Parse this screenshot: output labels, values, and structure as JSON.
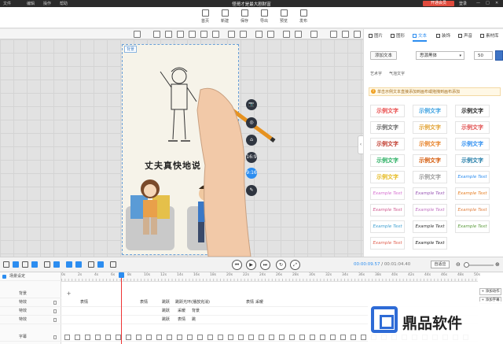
{
  "titlebar": {
    "menu": [
      "文件",
      "编辑",
      "操作",
      "帮助"
    ],
    "title": "怪哥才是最大剧财富",
    "vip": "开通会员",
    "login": "登录",
    "window_controls": [
      "—",
      "□",
      "✕"
    ]
  },
  "toolbar": {
    "items": [
      {
        "label": "首页",
        "icon": "home-icon"
      },
      {
        "label": "新建",
        "icon": "new-icon"
      },
      {
        "label": "保存",
        "icon": "save-icon"
      },
      {
        "label": "导出",
        "icon": "export-icon"
      },
      {
        "label": "预览",
        "icon": "preview-icon"
      },
      {
        "label": "发布",
        "icon": "publish-icon"
      }
    ]
  },
  "canvas": {
    "stage_label": "背景",
    "caption": "丈夫真快地说",
    "side_buttons": [
      "📷",
      "◎",
      "⌂",
      "16:9",
      "9:16",
      "✎"
    ]
  },
  "right_panel": {
    "tabs": [
      "图片",
      "图形",
      "文本",
      "装饰",
      "声音",
      "素材库"
    ],
    "active_tab": "文本",
    "add_text": "添加文本",
    "font": "思源黑体",
    "font_size": "50",
    "color": "#3e74c6",
    "subtabs": [
      "艺术字",
      "气泡文字"
    ],
    "tip": "单击示例文本直接添加到画布或拖拽到画布添加",
    "styles": [
      "示例文字",
      "示例文字",
      "示例文字",
      "示例文字",
      "示例文字",
      "示例文字",
      "示例文字",
      "示例文字",
      "示例文字",
      "示例文字",
      "示例文字",
      "示例文字",
      "示例文字",
      "示例文字",
      "Example Text",
      "Example Text",
      "Example Text",
      "Example Text",
      "Example Text",
      "Example Text",
      "Example Text",
      "Example Text",
      "Example Text",
      "Example Text",
      "Example Text",
      "Example Text"
    ],
    "style_colors": [
      "#e94b4b",
      "#3aa0e0",
      "#222222",
      "#666666",
      "#e0a030",
      "#e05050",
      "#c0392b",
      "#e67e22",
      "#2c8df0",
      "#27ae60",
      "#d35400",
      "#1f7aa6",
      "#e5b91e",
      "#999999",
      "#2c8df0",
      "#d66fd0",
      "#9b59b6",
      "#e67e22",
      "#d05a8f",
      "#c070c0",
      "#e08040",
      "#40a0d0",
      "#333333",
      "#5a9a3a",
      "#e06050",
      "#222222"
    ]
  },
  "playbar": {
    "timecode_current": "00:00:09.57",
    "timecode_total": "00:01:04.40",
    "fit_label": "自适应"
  },
  "timeline": {
    "ruler_labels": [
      "0s",
      "2s",
      "4s",
      "6s",
      "8s",
      "10s",
      "12s",
      "14s",
      "16s",
      "18s",
      "20s",
      "22s",
      "24s",
      "26s",
      "28s",
      "30s",
      "32s",
      "34s",
      "36s",
      "38s",
      "40s",
      "42s",
      "44s",
      "46s",
      "48s",
      "50s"
    ],
    "tracks": [
      {
        "label": "场景设定",
        "header": true
      },
      {
        "label": "背景"
      },
      {
        "label": "特效"
      },
      {
        "label": "特效"
      },
      {
        "label": "特效"
      },
      {
        "label": "字幕"
      }
    ],
    "clips_row2": [
      "表情",
      "表情",
      "跳跃",
      "跳跃光环(播放完消)",
      "表情",
      "采暖"
    ],
    "clips_row3": [
      "跳跃",
      "采暖",
      "背景"
    ],
    "clips_row4": [
      "跳跃",
      "表情",
      "跳"
    ],
    "add_action": "+ 添加动作",
    "add_track": "+ 添加字幕"
  },
  "watermark": {
    "brand": "鼎品软件"
  }
}
